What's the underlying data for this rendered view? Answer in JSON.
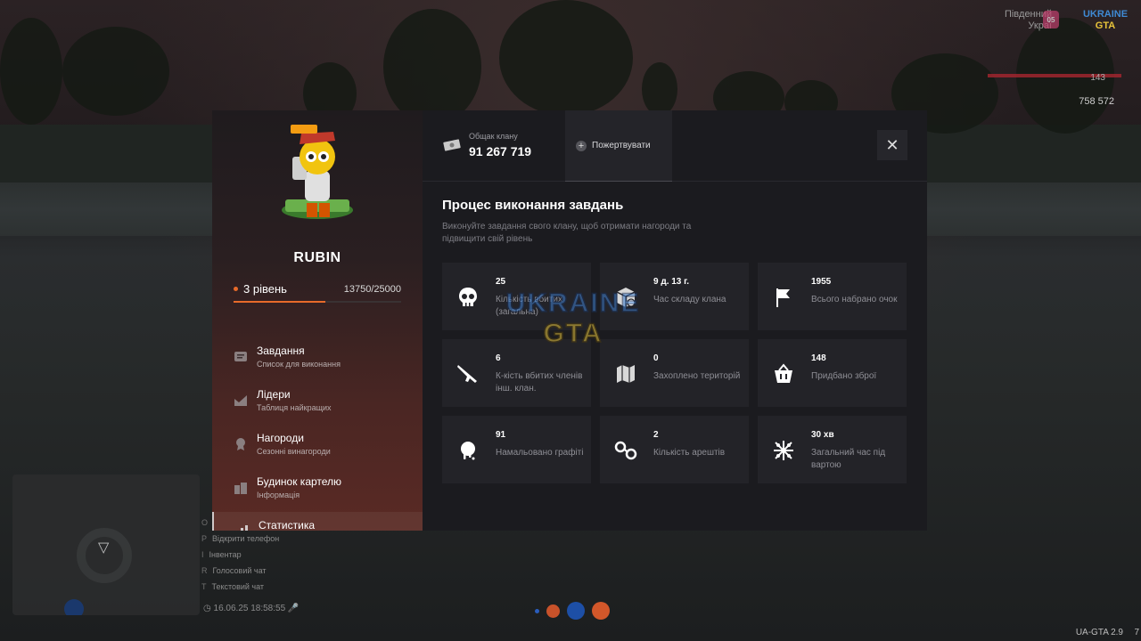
{
  "hud": {
    "server_line1": "Південний",
    "server_line2": "Украї",
    "server_badge": "05",
    "logo_top": "UKRAINE",
    "logo_bottom": "GTA",
    "money_top": "143",
    "money": "758 572",
    "version": "UA-GTA 2.9",
    "version_extra": "7",
    "clock": "16.06.25 18:58:55",
    "hotkeys": [
      {
        "key": "O",
        "label": ""
      },
      {
        "key": "P",
        "label": "Відкрити телефон"
      },
      {
        "key": "I",
        "label": "Інвентар"
      },
      {
        "key": "R",
        "label": "Голосовий чат"
      },
      {
        "key": "T",
        "label": "Текстовий чат"
      }
    ]
  },
  "clan": {
    "name": "RUBIN",
    "level_label": "3 рівень",
    "xp": "13750/25000",
    "xp_fraction": 0.55
  },
  "menu": [
    {
      "title": "Завдання",
      "subtitle": "Список для виконання",
      "icon": "tasks-icon",
      "active": false
    },
    {
      "title": "Лідери",
      "subtitle": "Таблиця найкращих",
      "icon": "leaders-icon",
      "active": false
    },
    {
      "title": "Нагороди",
      "subtitle": "Сезонні винагороди",
      "icon": "rewards-icon",
      "active": false
    },
    {
      "title": "Будинок картелю",
      "subtitle": "Інформація",
      "icon": "house-icon",
      "active": false
    },
    {
      "title": "Статистика",
      "subtitle": "",
      "icon": "stats-icon",
      "active": true
    }
  ],
  "bank": {
    "label": "Общак клану",
    "value": "91 267 719",
    "donate_label": "Пожертвувати",
    "close_symbol": "✕"
  },
  "section": {
    "title": "Процес виконання завдань",
    "description": "Виконуйте завдання свого клану, щоб отримати нагороди та підвищити свій рівень"
  },
  "stats": [
    {
      "value": "25",
      "label": "Кількість вбитих (загальна)",
      "icon": "skull-icon"
    },
    {
      "value": "9 д. 13 г.",
      "label": "Час складу клана",
      "icon": "box-icon"
    },
    {
      "value": "1955",
      "label": "Всього набрано очок",
      "icon": "flag-icon"
    },
    {
      "value": "6",
      "label": "К-кість вбитих членів інш. клан.",
      "icon": "rifle-icon"
    },
    {
      "value": "0",
      "label": "Захоплено територій",
      "icon": "map-icon"
    },
    {
      "value": "148",
      "label": "Придбано зброї",
      "icon": "basket-icon"
    },
    {
      "value": "91",
      "label": "Намальовано графіті",
      "icon": "spray-icon"
    },
    {
      "value": "2",
      "label": "Кількість арештів",
      "icon": "handcuffs-icon"
    },
    {
      "value": "30 хв",
      "label": "Загальний час під вартою",
      "icon": "barbed-wire-icon"
    }
  ],
  "colors": {
    "accent": "#e76a2a",
    "panel": "#1b1b1f",
    "card": "#232328"
  }
}
